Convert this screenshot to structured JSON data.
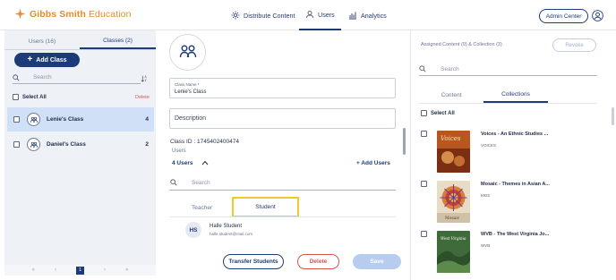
{
  "app": {
    "brand_bold": "Gibbs Smith",
    "brand_regular": " Education"
  },
  "nav": {
    "distribute": "Distribute Content",
    "users": "Users",
    "analytics": "Analytics",
    "admin_center": "Admin Center"
  },
  "left": {
    "tab_users": "Users (16)",
    "tab_classes": "Classes (2)",
    "add_class": "Add Class",
    "search_placeholder": "Search",
    "select_all": "Select All",
    "delete": "Delete",
    "classes": [
      {
        "name": "Lenie's Class",
        "count": "4"
      },
      {
        "name": "Daniel's Class",
        "count": "2"
      }
    ],
    "pager": {
      "first": "«",
      "prev": "‹",
      "current": "1",
      "next": "›",
      "last": "»"
    }
  },
  "middle": {
    "class_name_label": "Class Name *",
    "class_name_value": "Lenie's Class",
    "description_placeholder": "Description",
    "class_id": "Class ID : 1745402400474",
    "users_label": "Users",
    "users_count": "4 Users",
    "add_users": "+ Add Users",
    "search_placeholder": "Search",
    "tab_teacher": "Teacher",
    "tab_student": "Student",
    "student": {
      "initials": "HS",
      "name": "Halle Student",
      "email": "halle.student@mail.com"
    },
    "transfer_students": "Transfer Students",
    "delete": "Delete",
    "save": "Save"
  },
  "right": {
    "assigned": "Assigned Content (0) & Collection (3)",
    "revoke": "Revoke",
    "search_placeholder": "Search",
    "tab_content": "Content",
    "tab_collections": "Collections",
    "select_all": "Select All",
    "collections": [
      {
        "title": "Voices - An Ethnic Studies ...",
        "sub": "VOICES",
        "cover_text": "Voices"
      },
      {
        "title": "Mosaic - Themes in Asian A...",
        "sub": "MOS",
        "cover_text": "Mosaic"
      },
      {
        "title": "WVB - The West Virginia Jo...",
        "sub": "WVB",
        "cover_text": "West Virginia"
      }
    ]
  },
  "colors": {
    "primary": "#1d3b78",
    "brand": "#e38d2f",
    "danger": "#d9534f",
    "highlight": "#f1c92c"
  }
}
